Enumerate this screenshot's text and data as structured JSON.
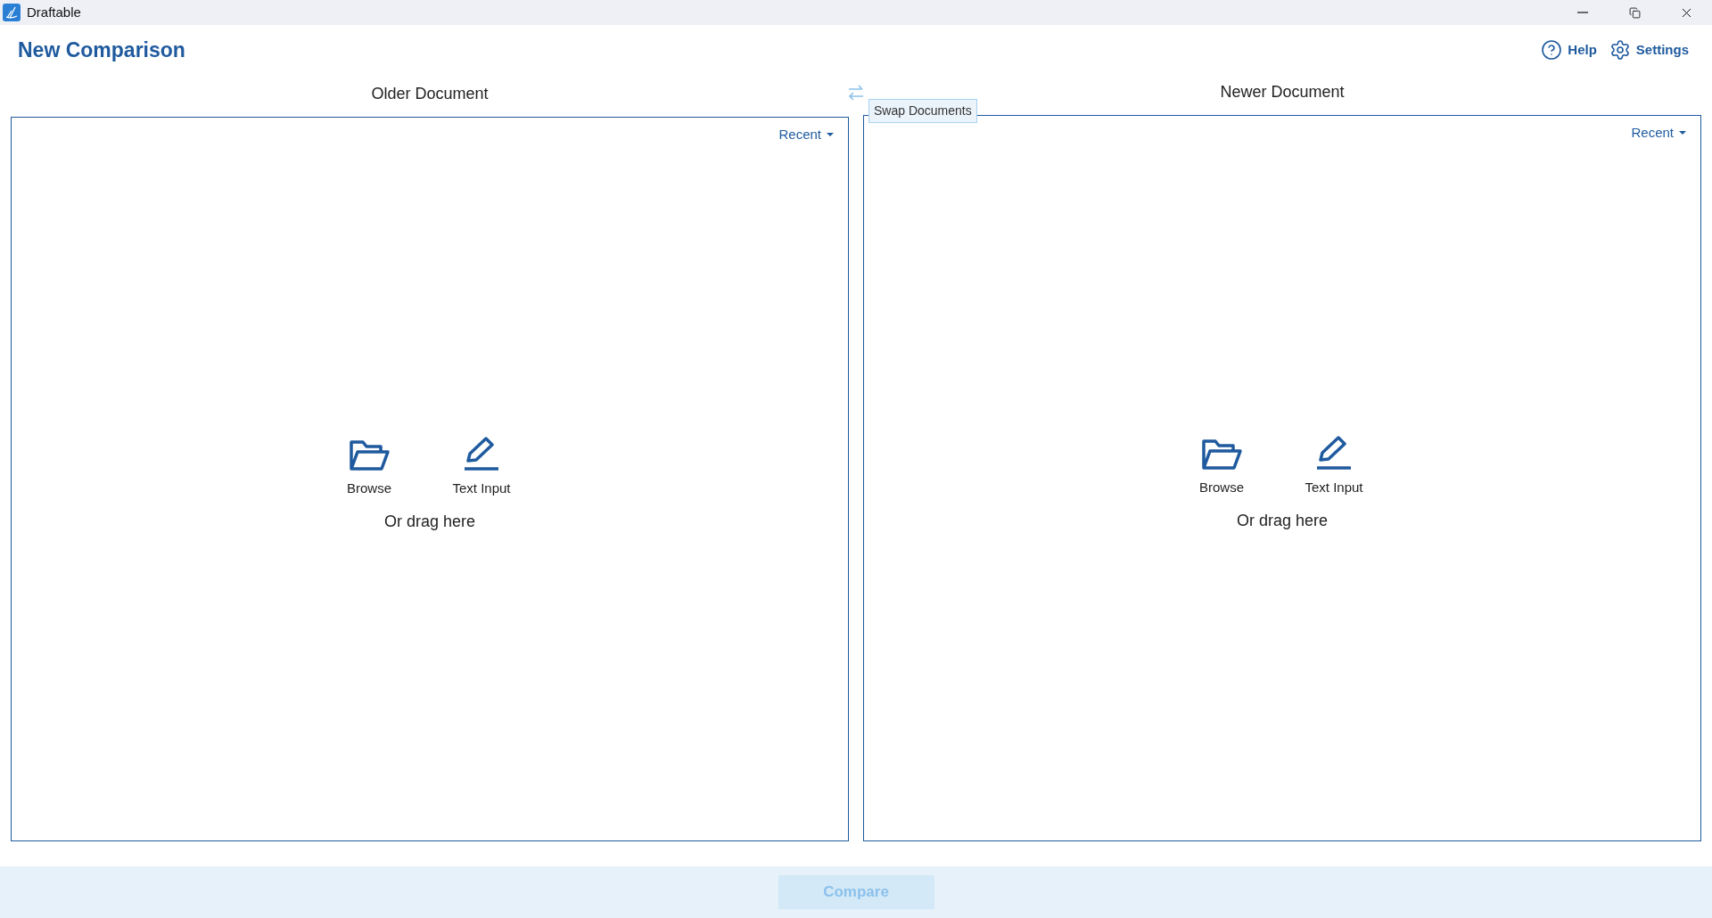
{
  "window": {
    "title": "Draftable"
  },
  "header": {
    "title": "New Comparison",
    "links": [
      {
        "kind": "help",
        "label": "Help"
      },
      {
        "kind": "settings",
        "label": "Settings"
      }
    ]
  },
  "swap": {
    "tooltip": "Swap Documents"
  },
  "documents": [
    {
      "title": "Older Document",
      "recent": "Recent",
      "actions": [
        {
          "kind": "browse",
          "label": "Browse"
        },
        {
          "kind": "text",
          "label": "Text Input"
        }
      ],
      "drag_hint": "Or drag here"
    },
    {
      "title": "Newer Document",
      "recent": "Recent",
      "actions": [
        {
          "kind": "browse",
          "label": "Browse"
        },
        {
          "kind": "text",
          "label": "Text Input"
        }
      ],
      "drag_hint": "Or drag here"
    }
  ],
  "compare_button": {
    "label": "Compare",
    "disabled": true
  }
}
